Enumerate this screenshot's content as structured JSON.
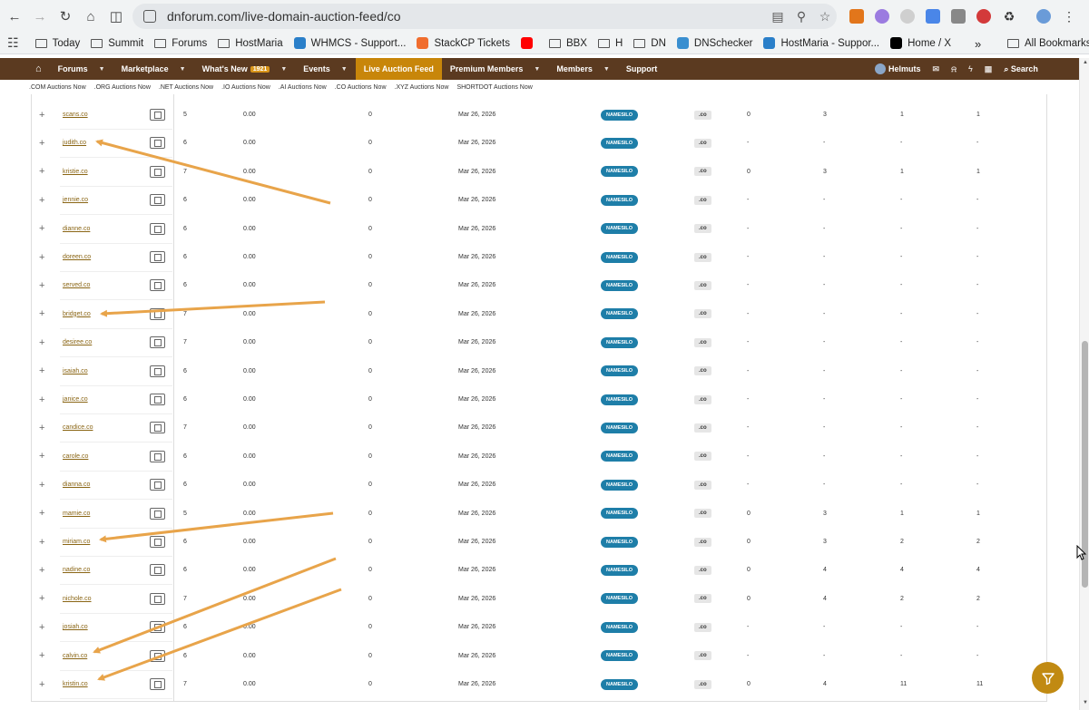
{
  "browser": {
    "url": "dnforum.com/live-domain-auction-feed/co",
    "bookmarks": [
      {
        "label": "",
        "icon": "apps-grid-icon"
      },
      {
        "label": "Today",
        "icon": "folder-icon"
      },
      {
        "label": "Summit",
        "icon": "folder-icon"
      },
      {
        "label": "Forums",
        "icon": "folder-icon"
      },
      {
        "label": "HostMaria",
        "icon": "folder-icon"
      },
      {
        "label": "WHMCS - Support...",
        "icon": "whmcs-icon"
      },
      {
        "label": "StackCP Tickets",
        "icon": "stackcp-icon"
      },
      {
        "label": "",
        "icon": "youtube-icon"
      },
      {
        "label": "BBX",
        "icon": "folder-icon"
      },
      {
        "label": "H",
        "icon": "folder-icon"
      },
      {
        "label": "DN",
        "icon": "folder-icon"
      },
      {
        "label": "DNSchecker",
        "icon": "dnschecker-icon"
      },
      {
        "label": "HostMaria - Suppor...",
        "icon": "whmcs-icon"
      },
      {
        "label": "Home / X",
        "icon": "x-icon"
      }
    ],
    "more": "»",
    "all_bookmarks": "All Bookmarks"
  },
  "nav": {
    "items": [
      {
        "label": "",
        "caret": false,
        "active": false,
        "icon": "home-icon"
      },
      {
        "label": "Forums",
        "caret": true,
        "active": false
      },
      {
        "label": "Marketplace",
        "caret": true,
        "active": false
      },
      {
        "label": "What's New",
        "badge": "1921",
        "caret": true,
        "active": false
      },
      {
        "label": "Events",
        "caret": true,
        "active": false
      },
      {
        "label": "Live Auction Feed",
        "caret": false,
        "active": true
      },
      {
        "label": "Premium Members",
        "caret": true,
        "active": false
      },
      {
        "label": "Members",
        "caret": true,
        "active": false
      },
      {
        "label": "Support",
        "caret": false,
        "active": false
      }
    ],
    "user": "Helmuts",
    "search": "Search"
  },
  "subnav": [
    ".COM Auctions Now",
    ".ORG Auctions Now",
    ".NET Auctions Now",
    ".IO Auctions Now",
    ".AI Auctions Now",
    ".CO Auctions Now",
    ".XYZ Auctions Now",
    "SHORTDOT Auctions Now"
  ],
  "rows": [
    {
      "domain": "scans.co",
      "len": "5",
      "price": "0.00",
      "bids": "0",
      "date": "Mar 26, 2026",
      "registrar": "NAMESILO",
      "tld": ".co",
      "a": "0",
      "b": "3",
      "c": "1",
      "d": "1"
    },
    {
      "domain": "judith.co",
      "len": "6",
      "price": "0.00",
      "bids": "0",
      "date": "Mar 26, 2026",
      "registrar": "NAMESILO",
      "tld": ".co",
      "a": "-",
      "b": "-",
      "c": "-",
      "d": "-"
    },
    {
      "domain": "kristie.co",
      "len": "7",
      "price": "0.00",
      "bids": "0",
      "date": "Mar 26, 2026",
      "registrar": "NAMESILO",
      "tld": ".co",
      "a": "0",
      "b": "3",
      "c": "1",
      "d": "1"
    },
    {
      "domain": "jennie.co",
      "len": "6",
      "price": "0.00",
      "bids": "0",
      "date": "Mar 26, 2026",
      "registrar": "NAMESILO",
      "tld": ".co",
      "a": "-",
      "b": "-",
      "c": "-",
      "d": "-"
    },
    {
      "domain": "dianne.co",
      "len": "6",
      "price": "0.00",
      "bids": "0",
      "date": "Mar 26, 2026",
      "registrar": "NAMESILO",
      "tld": ".co",
      "a": "-",
      "b": "-",
      "c": "-",
      "d": "-"
    },
    {
      "domain": "doreen.co",
      "len": "6",
      "price": "0.00",
      "bids": "0",
      "date": "Mar 26, 2026",
      "registrar": "NAMESILO",
      "tld": ".co",
      "a": "-",
      "b": "-",
      "c": "-",
      "d": "-"
    },
    {
      "domain": "served.co",
      "len": "6",
      "price": "0.00",
      "bids": "0",
      "date": "Mar 26, 2026",
      "registrar": "NAMESILO",
      "tld": ".co",
      "a": "-",
      "b": "-",
      "c": "-",
      "d": "-"
    },
    {
      "domain": "bridget.co",
      "len": "7",
      "price": "0.00",
      "bids": "0",
      "date": "Mar 26, 2026",
      "registrar": "NAMESILO",
      "tld": ".co",
      "a": "-",
      "b": "-",
      "c": "-",
      "d": "-"
    },
    {
      "domain": "desiree.co",
      "len": "7",
      "price": "0.00",
      "bids": "0",
      "date": "Mar 26, 2026",
      "registrar": "NAMESILO",
      "tld": ".co",
      "a": "-",
      "b": "-",
      "c": "-",
      "d": "-"
    },
    {
      "domain": "isaiah.co",
      "len": "6",
      "price": "0.00",
      "bids": "0",
      "date": "Mar 26, 2026",
      "registrar": "NAMESILO",
      "tld": ".co",
      "a": "-",
      "b": "-",
      "c": "-",
      "d": "-"
    },
    {
      "domain": "janice.co",
      "len": "6",
      "price": "0.00",
      "bids": "0",
      "date": "Mar 26, 2026",
      "registrar": "NAMESILO",
      "tld": ".co",
      "a": "-",
      "b": "-",
      "c": "-",
      "d": "-"
    },
    {
      "domain": "candice.co",
      "len": "7",
      "price": "0.00",
      "bids": "0",
      "date": "Mar 26, 2026",
      "registrar": "NAMESILO",
      "tld": ".co",
      "a": "-",
      "b": "-",
      "c": "-",
      "d": "-"
    },
    {
      "domain": "carole.co",
      "len": "6",
      "price": "0.00",
      "bids": "0",
      "date": "Mar 26, 2026",
      "registrar": "NAMESILO",
      "tld": ".co",
      "a": "-",
      "b": "-",
      "c": "-",
      "d": "-"
    },
    {
      "domain": "dianna.co",
      "len": "6",
      "price": "0.00",
      "bids": "0",
      "date": "Mar 26, 2026",
      "registrar": "NAMESILO",
      "tld": ".co",
      "a": "-",
      "b": "-",
      "c": "-",
      "d": "-"
    },
    {
      "domain": "mamie.co",
      "len": "5",
      "price": "0.00",
      "bids": "0",
      "date": "Mar 26, 2026",
      "registrar": "NAMESILO",
      "tld": ".co",
      "a": "0",
      "b": "3",
      "c": "1",
      "d": "1"
    },
    {
      "domain": "miriam.co",
      "len": "6",
      "price": "0.00",
      "bids": "0",
      "date": "Mar 26, 2026",
      "registrar": "NAMESILO",
      "tld": ".co",
      "a": "0",
      "b": "3",
      "c": "2",
      "d": "2"
    },
    {
      "domain": "nadine.co",
      "len": "6",
      "price": "0.00",
      "bids": "0",
      "date": "Mar 26, 2026",
      "registrar": "NAMESILO",
      "tld": ".co",
      "a": "0",
      "b": "4",
      "c": "4",
      "d": "4"
    },
    {
      "domain": "nichole.co",
      "len": "7",
      "price": "0.00",
      "bids": "0",
      "date": "Mar 26, 2026",
      "registrar": "NAMESILO",
      "tld": ".co",
      "a": "0",
      "b": "4",
      "c": "2",
      "d": "2"
    },
    {
      "domain": "josiah.co",
      "len": "6",
      "price": "0.00",
      "bids": "0",
      "date": "Mar 26, 2026",
      "registrar": "NAMESILO",
      "tld": ".co",
      "a": "-",
      "b": "-",
      "c": "-",
      "d": "-"
    },
    {
      "domain": "calvin.co",
      "len": "6",
      "price": "0.00",
      "bids": "0",
      "date": "Mar 26, 2026",
      "registrar": "NAMESILO",
      "tld": ".co",
      "a": "-",
      "b": "-",
      "c": "-",
      "d": "-"
    },
    {
      "domain": "kristin.co",
      "len": "7",
      "price": "0.00",
      "bids": "0",
      "date": "Mar 26, 2026",
      "registrar": "NAMESILO",
      "tld": ".co",
      "a": "0",
      "b": "4",
      "c": "11",
      "d": "11"
    }
  ],
  "colors": {
    "nav_bg": "#5b3a20",
    "accent": "#c8860a",
    "link": "#8a6514",
    "registrar_badge": "#1e7ea8",
    "annotation_arrow": "#e8a44a"
  }
}
